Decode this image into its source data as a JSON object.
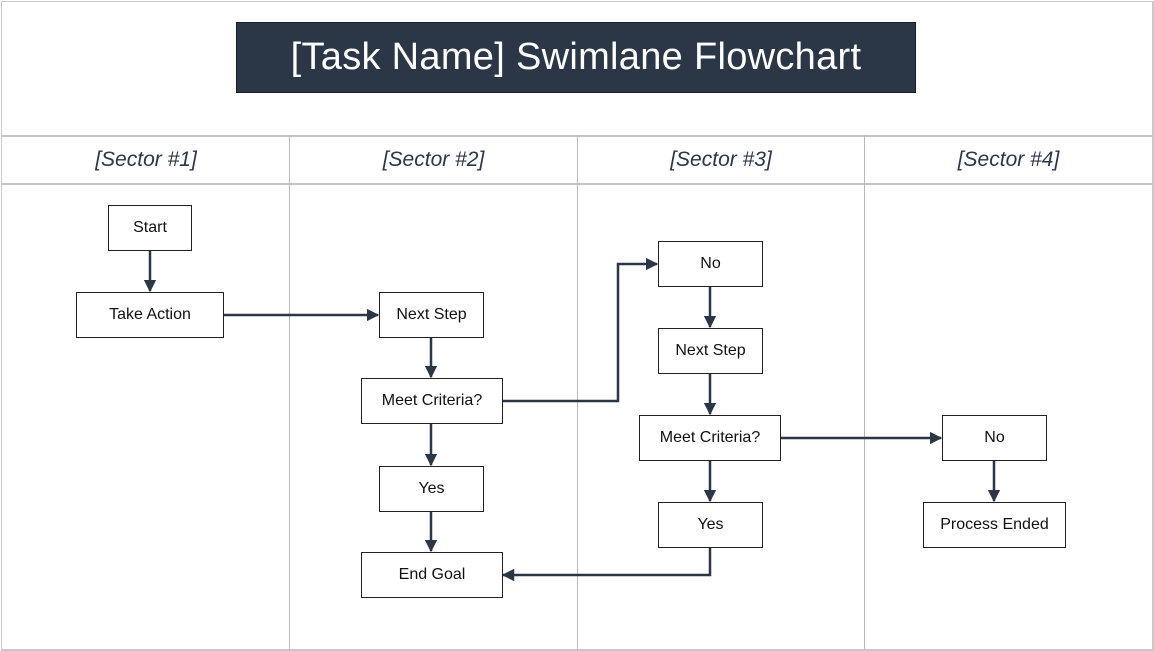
{
  "title": "[Task Name] Swimlane Flowchart",
  "colors": {
    "title_bg": "#2b3646",
    "title_text": "#ffffff",
    "connector": "#2b3646",
    "lane_header_text": "#2b3646",
    "grid_line": "#c4c4c4"
  },
  "lanes": [
    {
      "label": "[Sector #1]"
    },
    {
      "label": "[Sector #2]"
    },
    {
      "label": "[Sector #3]"
    },
    {
      "label": "[Sector #4]"
    }
  ],
  "nodes": {
    "start": {
      "label": "Start",
      "lane": 1
    },
    "take_action": {
      "label": "Take Action",
      "lane": 1
    },
    "next_step_2": {
      "label": "Next Step",
      "lane": 2
    },
    "meet_criteria_2": {
      "label": "Meet Criteria?",
      "lane": 2
    },
    "yes_2": {
      "label": "Yes",
      "lane": 2
    },
    "end_goal": {
      "label": "End Goal",
      "lane": 2
    },
    "no_3": {
      "label": "No",
      "lane": 3
    },
    "next_step_3": {
      "label": "Next Step",
      "lane": 3
    },
    "meet_criteria_3": {
      "label": "Meet Criteria?",
      "lane": 3
    },
    "yes_3": {
      "label": "Yes",
      "lane": 3
    },
    "no_4": {
      "label": "No",
      "lane": 4
    },
    "process_ended": {
      "label": "Process Ended",
      "lane": 4
    }
  },
  "edges": [
    {
      "from": "start",
      "to": "take_action"
    },
    {
      "from": "take_action",
      "to": "next_step_2"
    },
    {
      "from": "next_step_2",
      "to": "meet_criteria_2"
    },
    {
      "from": "meet_criteria_2",
      "to": "yes_2"
    },
    {
      "from": "yes_2",
      "to": "end_goal"
    },
    {
      "from": "meet_criteria_2",
      "to": "no_3"
    },
    {
      "from": "no_3",
      "to": "next_step_3"
    },
    {
      "from": "next_step_3",
      "to": "meet_criteria_3"
    },
    {
      "from": "meet_criteria_3",
      "to": "yes_3"
    },
    {
      "from": "yes_3",
      "to": "end_goal"
    },
    {
      "from": "meet_criteria_3",
      "to": "no_4"
    },
    {
      "from": "no_4",
      "to": "process_ended"
    }
  ]
}
